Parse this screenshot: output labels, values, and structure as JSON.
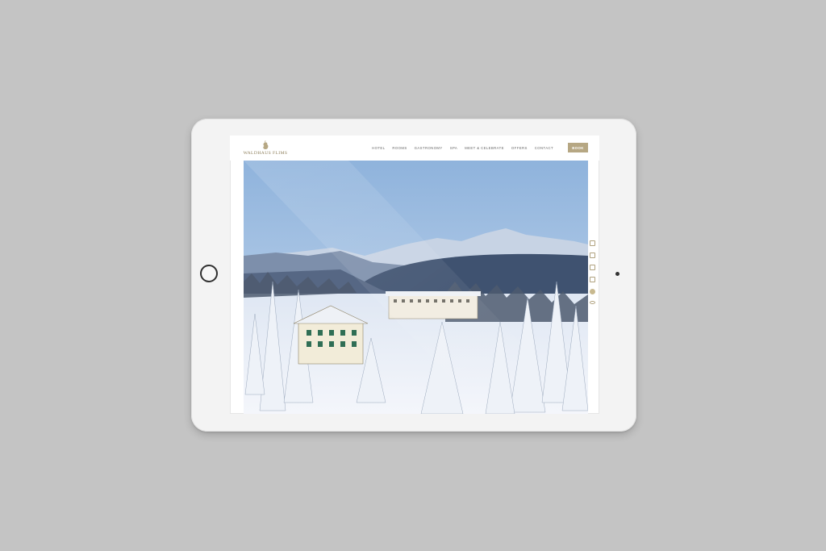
{
  "site": {
    "logo_text": "WALDHAUS FLIMS",
    "nav": [
      "HOTEL",
      "ROOMS",
      "GASTRONOMY",
      "SPA",
      "MEET & CELEBRATE",
      "OFFERS",
      "CONTACT"
    ],
    "book_label": "BOOK",
    "brand_color": "#b6a783"
  },
  "side_icons": [
    "calendar-icon",
    "map-icon",
    "gift-icon",
    "document-icon",
    "info-icon",
    "eye-icon"
  ]
}
